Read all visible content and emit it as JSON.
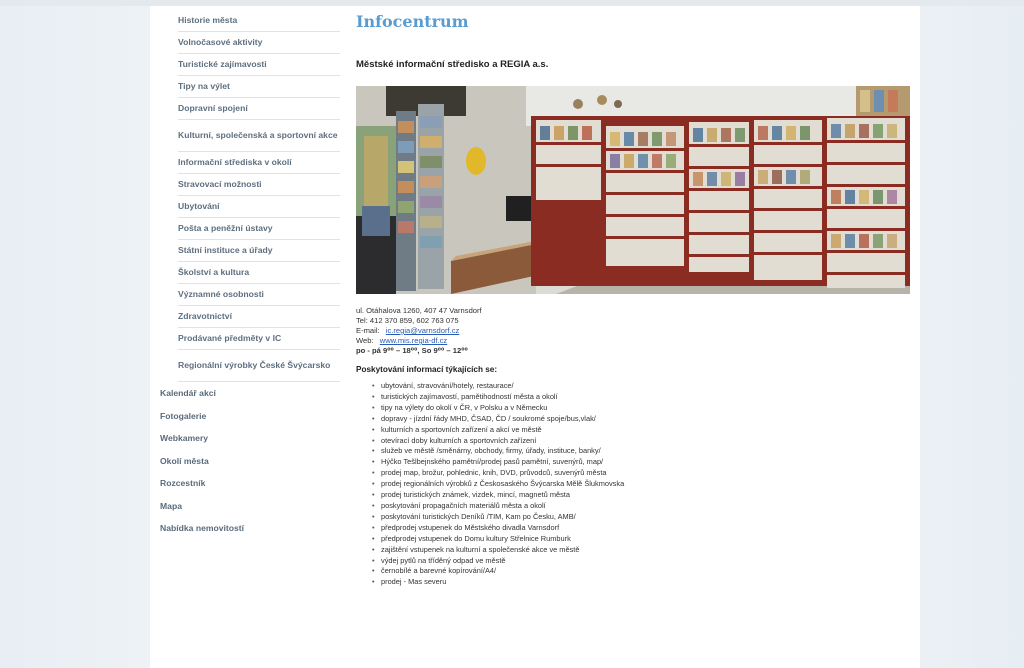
{
  "sidebar": {
    "sub_items": [
      "Historie města",
      "Volnočasové aktivity",
      "Turistické zajímavosti",
      "Tipy na výlet",
      "Dopravní spojení",
      "Kulturní, společenská a sportovní akce",
      "Informační střediska v okolí",
      "Stravovací možnosti",
      "Ubytování",
      "Pošta a peněžní ústavy",
      "Státní instituce a úřady",
      "Školství a kultura",
      "Významné osobnosti",
      "Zdravotnictví",
      "Prodávané předměty v IC",
      "Regionální výrobky České Švýcarsko"
    ],
    "main_items": [
      "Kalendář akcí",
      "Fotogalerie",
      "Webkamery",
      "Okolí města",
      "Rozcestník",
      "Mapa",
      "Nabídka nemovitostí"
    ]
  },
  "content": {
    "title": "Infocentrum",
    "subtitle": "Městské informační středisko a REGIA a.s.",
    "address": "ul. Otáhalova 1260, 407 47 Varnsdorf",
    "phone": "Tel: 412 370 859, 602 763 075",
    "email_label": "E-mail:",
    "email": "ic.regia@varnsdorf.cz",
    "web_label": "Web:",
    "web": "www.mis.regia-df.cz",
    "hours": "po - pá 9⁰⁰ – 18⁰⁰, So 9⁰⁰ – 12⁰⁰",
    "services_heading": "Poskytování informací týkajících se:",
    "services": [
      "ubytování, stravování/hotely, restaurace/",
      "turistických zajímavostí, pamětihodností města a okolí",
      "tipy na výlety do okolí v ČR, v Polsku a v Německu",
      "dopravy - jízdní řády MHD, ČSAD, ČD / soukromé spoje/bus,vlak/",
      "kulturních a sportovních zařízení a akcí ve městě",
      "otevírací doby kulturních a sportovních zařízení",
      "služeb ve městě /směnárny, obchody, firmy, úřady, instituce, banky/",
      "Hýčko Tešlbejnského pamětní/prodej pasů pamětní, suvenýrů, map/",
      "prodej map, brožur, pohlednic, knih, DVD, průvodců, suvenýrů města",
      "prodej regionálních výrobků z Českosaského Švýcarska Mělě Šlukmovska",
      "prodej turistických známek, vizdek, mincí, magnetů města",
      "poskytování propagačních materiálů města a okolí",
      "poskytování turistických Deníků /TIM, Kam po Česku, AMB/",
      "předprodej vstupenek do Městského divadla Varnsdorf",
      "předprodej vstupenek do Domu kultury Střelnice Rumburk",
      "zajištění vstupenek na kulturní a společenské akce ve městě",
      "výdej pytlů na tříděný odpad ve městě",
      "černobílé a barevné kopírování/A4/",
      "prodej - Mas severu"
    ]
  },
  "colors": {
    "title_blue": "#5a9bd0",
    "link_blue": "#2a5bb8",
    "nav_text": "#5e6f7f",
    "shelf_red": "#8b2c22"
  },
  "icons": [
    "bullet-icon"
  ]
}
